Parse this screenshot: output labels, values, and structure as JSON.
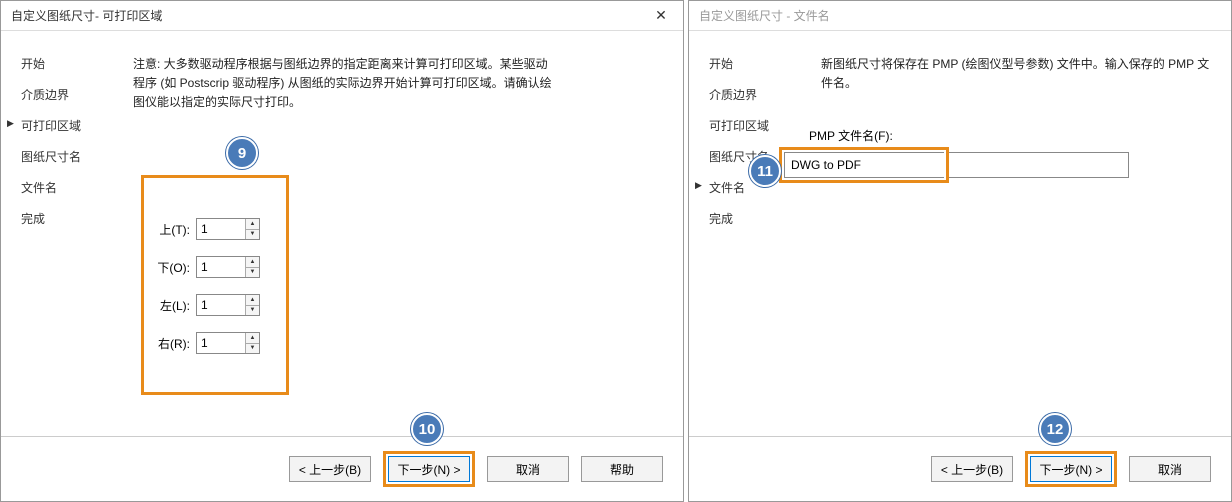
{
  "dialogLeft": {
    "title": "自定义图纸尺寸- 可打印区域",
    "sidebar": [
      "开始",
      "介质边界",
      "可打印区域",
      "图纸尺寸名",
      "文件名",
      "完成"
    ],
    "activeIndex": 2,
    "instructions": "注意: 大多数驱动程序根据与图纸边界的指定距离来计算可打印区域。某些驱动程序 (如 Postscrip 驱动程序) 从图纸的实际边界开始计算可打印区域。请确认绘图仪能以指定的实际尺寸打印。",
    "margins": {
      "top": {
        "label": "上(T):",
        "value": "1"
      },
      "bottom": {
        "label": "下(O):",
        "value": "1"
      },
      "left": {
        "label": "左(L):",
        "value": "1"
      },
      "right": {
        "label": "右(R):",
        "value": "1"
      }
    },
    "buttons": {
      "back": "< 上一步(B)",
      "next": "下一步(N) >",
      "cancel": "取消",
      "help": "帮助"
    }
  },
  "dialogRight": {
    "title": "自定义图纸尺寸 - 文件名",
    "sidebar": [
      "开始",
      "介质边界",
      "可打印区域",
      "图纸尺寸名",
      "文件名",
      "完成"
    ],
    "activeIndex": 4,
    "instructions": "新图纸尺寸将保存在 PMP (绘图仪型号参数) 文件中。输入保存的 PMP 文件名。",
    "filenameLabel": "PMP 文件名(F):",
    "filenameValue": "DWG to PDF",
    "buttons": {
      "back": "< 上一步(B)",
      "next": "下一步(N) >",
      "cancel": "取消"
    }
  },
  "badges": {
    "b9": "9",
    "b10": "10",
    "b11": "11",
    "b12": "12"
  }
}
